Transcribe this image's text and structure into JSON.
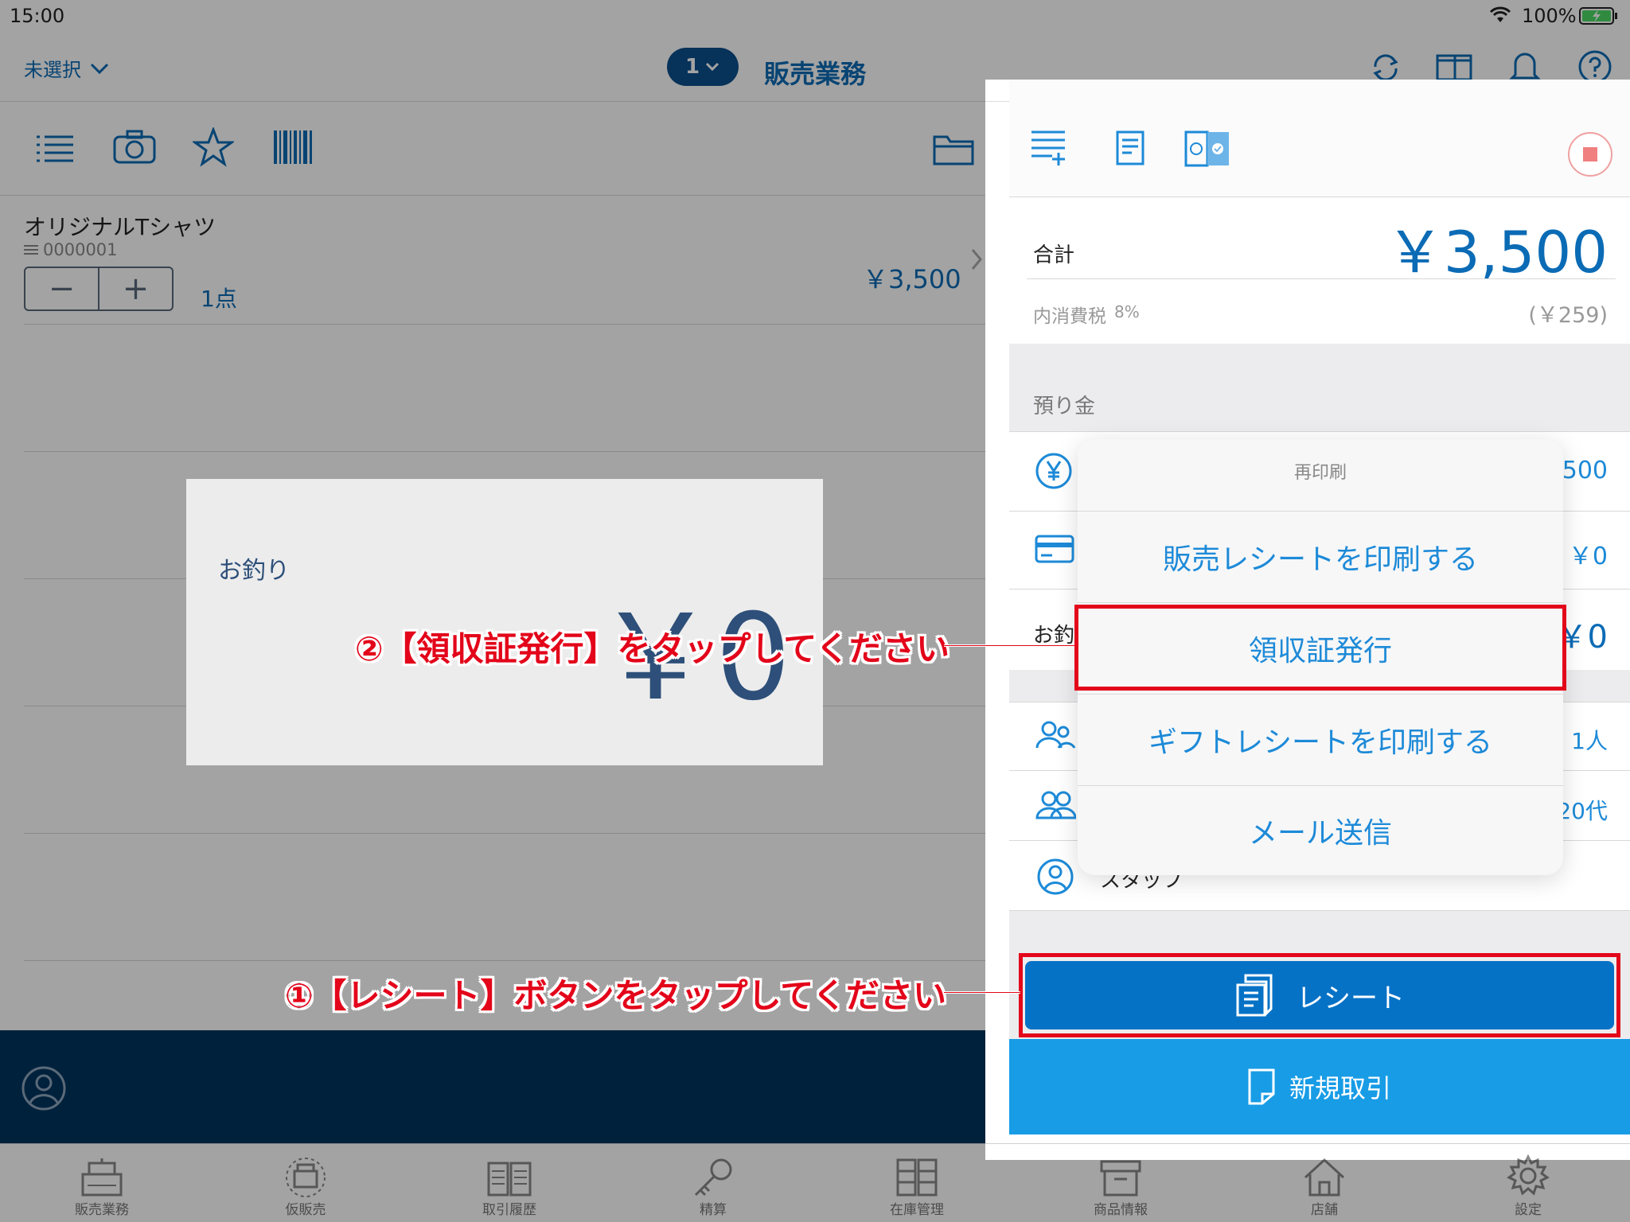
{
  "status": {
    "time": "15:00",
    "battery": "100%"
  },
  "header": {
    "store_select": "未選択",
    "register_number": "1",
    "title": "販売業務"
  },
  "cart": {
    "item_name": "オリジナルTシャツ",
    "item_code": "0000001",
    "item_qty": "1点",
    "item_price": "￥3,500"
  },
  "change_dialog": {
    "label": "お釣り",
    "amount": "￥0"
  },
  "panel": {
    "total_label": "合計",
    "total_amount": "￥3,500",
    "tax_label": "内消費税",
    "tax_rate": "8%",
    "tax_amount": "(￥259)",
    "deposit_label": "預り金",
    "cash_amount": "500",
    "card_amount": "￥0",
    "change_label": "お釣",
    "change_amount": "￥0",
    "people_count": "1人",
    "age_group": "20代",
    "staff_label": "スタッフ",
    "receipt_button": "レシート",
    "new_deal_button": "新規取引"
  },
  "reprint_menu": {
    "title": "再印刷",
    "items": [
      "販売レシートを印刷する",
      "領収証発行",
      "ギフトレシートを印刷する",
      "メール送信"
    ]
  },
  "annotations": {
    "step1": "①【レシート】ボタンをタップしてください",
    "step2": "②【領収証発行】をタップしてください",
    "color": "#e3051a"
  },
  "tabbar": {
    "items": [
      "販売業務",
      "仮販売",
      "取引履歴",
      "精算",
      "在庫管理",
      "商品情報",
      "店舗",
      "設定"
    ]
  },
  "colors": {
    "accent": "#0b6bb5",
    "receipt_button": "#0672c6",
    "new_deal": "#189ce6",
    "bottom_bar": "#00355f"
  }
}
